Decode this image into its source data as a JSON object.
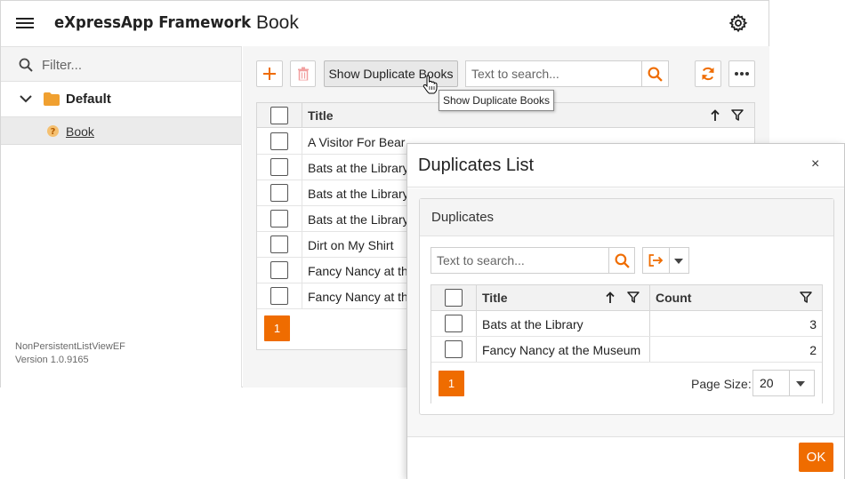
{
  "header": {
    "app_title": "eXpressApp Framework",
    "view_title": "Book"
  },
  "sidebar": {
    "filter_placeholder": "Filter...",
    "group_label": "Default",
    "items": [
      {
        "label": "Book"
      }
    ],
    "app_name": "NonPersistentListViewEF",
    "version": "Version 1.0.9165"
  },
  "toolbar": {
    "show_duplicates_label": "Show Duplicate Books",
    "search_placeholder": "Text to search...",
    "tooltip": "Show Duplicate Books"
  },
  "grid": {
    "column_title": "Title",
    "rows": [
      "A Visitor For Bear",
      "Bats at the Library",
      "Bats at the Library",
      "Bats at the Library",
      "Dirt on My Shirt",
      "Fancy Nancy at the",
      "Fancy Nancy at the"
    ],
    "page": "1"
  },
  "popup": {
    "title": "Duplicates List",
    "close_label": "×",
    "group_caption": "Duplicates",
    "search_placeholder": "Text to search...",
    "columns": {
      "title": "Title",
      "count": "Count"
    },
    "rows": [
      {
        "title": "Bats at the Library",
        "count": "3"
      },
      {
        "title": "Fancy Nancy at the Museum",
        "count": "2"
      }
    ],
    "page": "1",
    "page_size_label": "Page Size:",
    "page_size_value": "20",
    "ok_label": "OK"
  },
  "colors": {
    "accent": "#ef6c00",
    "folder": "#f0a030"
  }
}
